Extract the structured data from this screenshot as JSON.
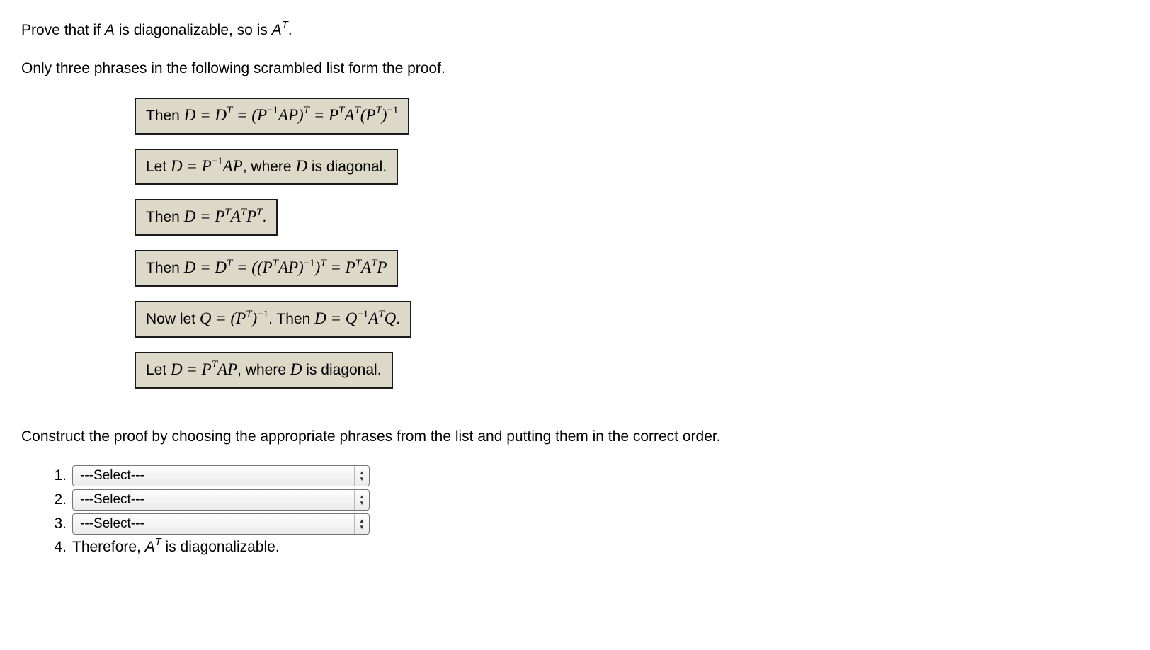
{
  "problem": {
    "line1_prefix": "Prove that if ",
    "line1_A": "A",
    "line1_mid": " is diagonalizable, so is ",
    "line1_AT_A": "A",
    "line1_AT_T": "T",
    "line1_suffix": ".",
    "line2": "Only three phrases in the following scrambled list form the proof."
  },
  "phrases": [
    {
      "prefix": "Then ",
      "math_html": "D = D<sup class='supm'>T</sup> = (P<sup class='supm'><span class='neg'>−1</span></sup>AP)<sup class='supm'>T</sup> = P<sup class='supm'>T</sup>A<sup class='supm'>T</sup>(P<sup class='supm'>T</sup>)<sup class='supm'><span class='neg'>−1</span></sup>"
    },
    {
      "prefix": "Let ",
      "math_html": "D = P<sup class='supm'><span class='neg'>−1</span></sup>AP",
      "suffix": ", where ",
      "math2_html": "D",
      "suffix2": " is diagonal."
    },
    {
      "prefix": "Then ",
      "math_html": "D = P<sup class='supm'>T</sup>A<sup class='supm'>T</sup>P<sup class='supm'>T</sup>",
      "suffix": "."
    },
    {
      "prefix": "Then ",
      "math_html": "D = D<sup class='supm'>T</sup> = ((P<sup class='supm'>T</sup>AP)<sup class='supm'><span class='neg'>−1</span></sup>)<sup class='supm'>T</sup> = P<sup class='supm'>T</sup>A<sup class='supm'>T</sup>P"
    },
    {
      "prefix": "Now let ",
      "math_html": "Q = (P<sup class='supm'>T</sup>)<sup class='supm'><span class='neg'>−1</span></sup>",
      "suffix": ". Then ",
      "math2_html": "D = Q<sup class='supm'><span class='neg'>−1</span></sup>A<sup class='supm'>T</sup>Q",
      "suffix2": "."
    },
    {
      "prefix": "Let ",
      "math_html": "D = P<sup class='supm'>T</sup>AP",
      "suffix": ", where ",
      "math2_html": "D",
      "suffix2": " is diagonal."
    }
  ],
  "construct": {
    "instruction": "Construct the proof by choosing the appropriate phrases from the list and putting them in the correct order.",
    "rows": [
      {
        "num": "1.",
        "placeholder": "---Select---"
      },
      {
        "num": "2.",
        "placeholder": "---Select---"
      },
      {
        "num": "3.",
        "placeholder": "---Select---"
      }
    ],
    "final_num": "4.",
    "final_prefix": " Therefore, ",
    "final_A": "A",
    "final_T": "T",
    "final_suffix": " is diagonalizable."
  }
}
